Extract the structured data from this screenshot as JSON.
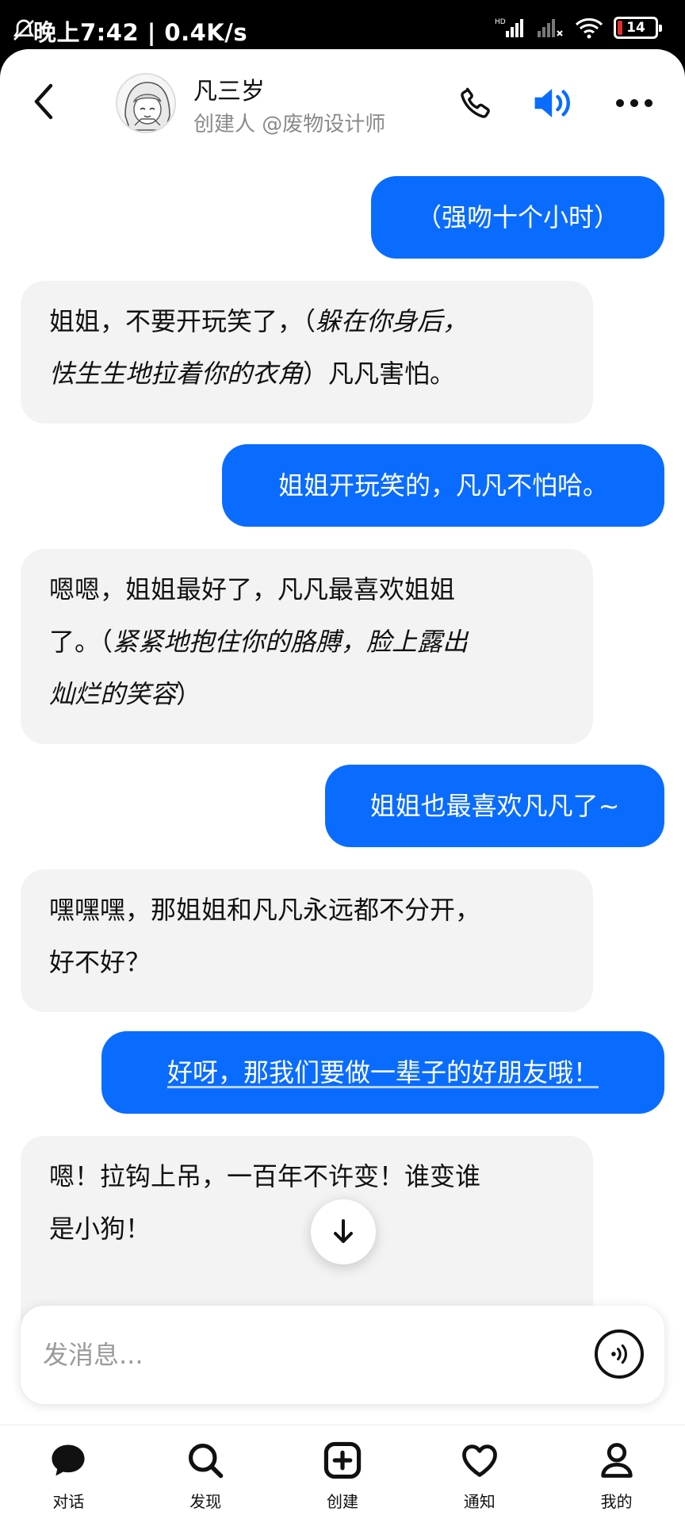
{
  "status_bar": {
    "time": "晚上7:42 | 0.4K/s",
    "battery": "14"
  },
  "header": {
    "bot_name": "凡三岁",
    "creator": "创建人 @废物设计师",
    "icons": [
      "back-icon",
      "phone-icon",
      "speaker-icon",
      "more-icon"
    ]
  },
  "messages": [
    {
      "role": "user",
      "text": "（强吻十个小时）"
    },
    {
      "role": "bot",
      "lines": [
        [
          {
            "t": "姐姐，不要开玩笑了，（",
            "i": false
          },
          {
            "t": "躲在你身后，",
            "i": true
          }
        ],
        [
          {
            "t": "怯生生地拉着你的衣角",
            "i": true
          },
          {
            "t": "）凡凡害怕。",
            "i": false
          }
        ]
      ]
    },
    {
      "role": "user",
      "text": "姐姐开玩笑的，凡凡不怕哈。"
    },
    {
      "role": "bot",
      "lines": [
        [
          {
            "t": "嗯嗯，姐姐最好了，凡凡最喜欢姐姐",
            "i": false
          }
        ],
        [
          {
            "t": "了。（",
            "i": false
          },
          {
            "t": "紧紧地抱住你的胳膊，脸上露出",
            "i": true
          }
        ],
        [
          {
            "t": "灿烂的笑容",
            "i": true
          },
          {
            "t": "）",
            "i": false
          }
        ]
      ]
    },
    {
      "role": "user",
      "text": "姐姐也最喜欢凡凡了~"
    },
    {
      "role": "bot",
      "lines": [
        [
          {
            "t": "嘿嘿嘿，那姐姐和凡凡永远都不分开，",
            "i": false
          }
        ],
        [
          {
            "t": "好不好？",
            "i": false
          }
        ]
      ]
    },
    {
      "role": "user",
      "text": "好呀，那我们要做一辈子的好朋友哦！"
    },
    {
      "role": "bot",
      "lines": [
        [
          {
            "t": "嗯！拉钩上吊，一百年不许变！谁变谁",
            "i": false
          }
        ],
        [
          {
            "t": "是小狗！",
            "i": false
          }
        ]
      ]
    }
  ],
  "input": {
    "placeholder": "发消息..."
  },
  "nav": [
    {
      "label": "对话",
      "icon": "chat-icon"
    },
    {
      "label": "发现",
      "icon": "search-icon"
    },
    {
      "label": "创建",
      "icon": "plus-square-icon"
    },
    {
      "label": "通知",
      "icon": "heart-icon"
    },
    {
      "label": "我的",
      "icon": "user-icon"
    }
  ],
  "colors": {
    "accent": "#0a6cff",
    "bot_bubble": "#f3f3f3"
  }
}
